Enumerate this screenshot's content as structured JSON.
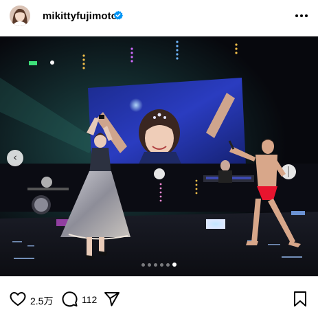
{
  "post": {
    "username": "mikittyfujimoto",
    "verified": true
  },
  "icons": {
    "avatar": "avatar-icon",
    "verified": "verified-badge-icon",
    "more": "more-options-icon",
    "previous": "chevron-left-icon",
    "like": "heart-icon",
    "comment": "comment-icon",
    "share": "send-icon",
    "save": "bookmark-icon"
  },
  "carousel": {
    "total": 6,
    "current": 6,
    "previous_glyph": "‹"
  },
  "actions": {
    "like_count": "2.5万",
    "comment_count": "112"
  },
  "colors": {
    "verified": "#0095f6",
    "text": "#000000"
  }
}
